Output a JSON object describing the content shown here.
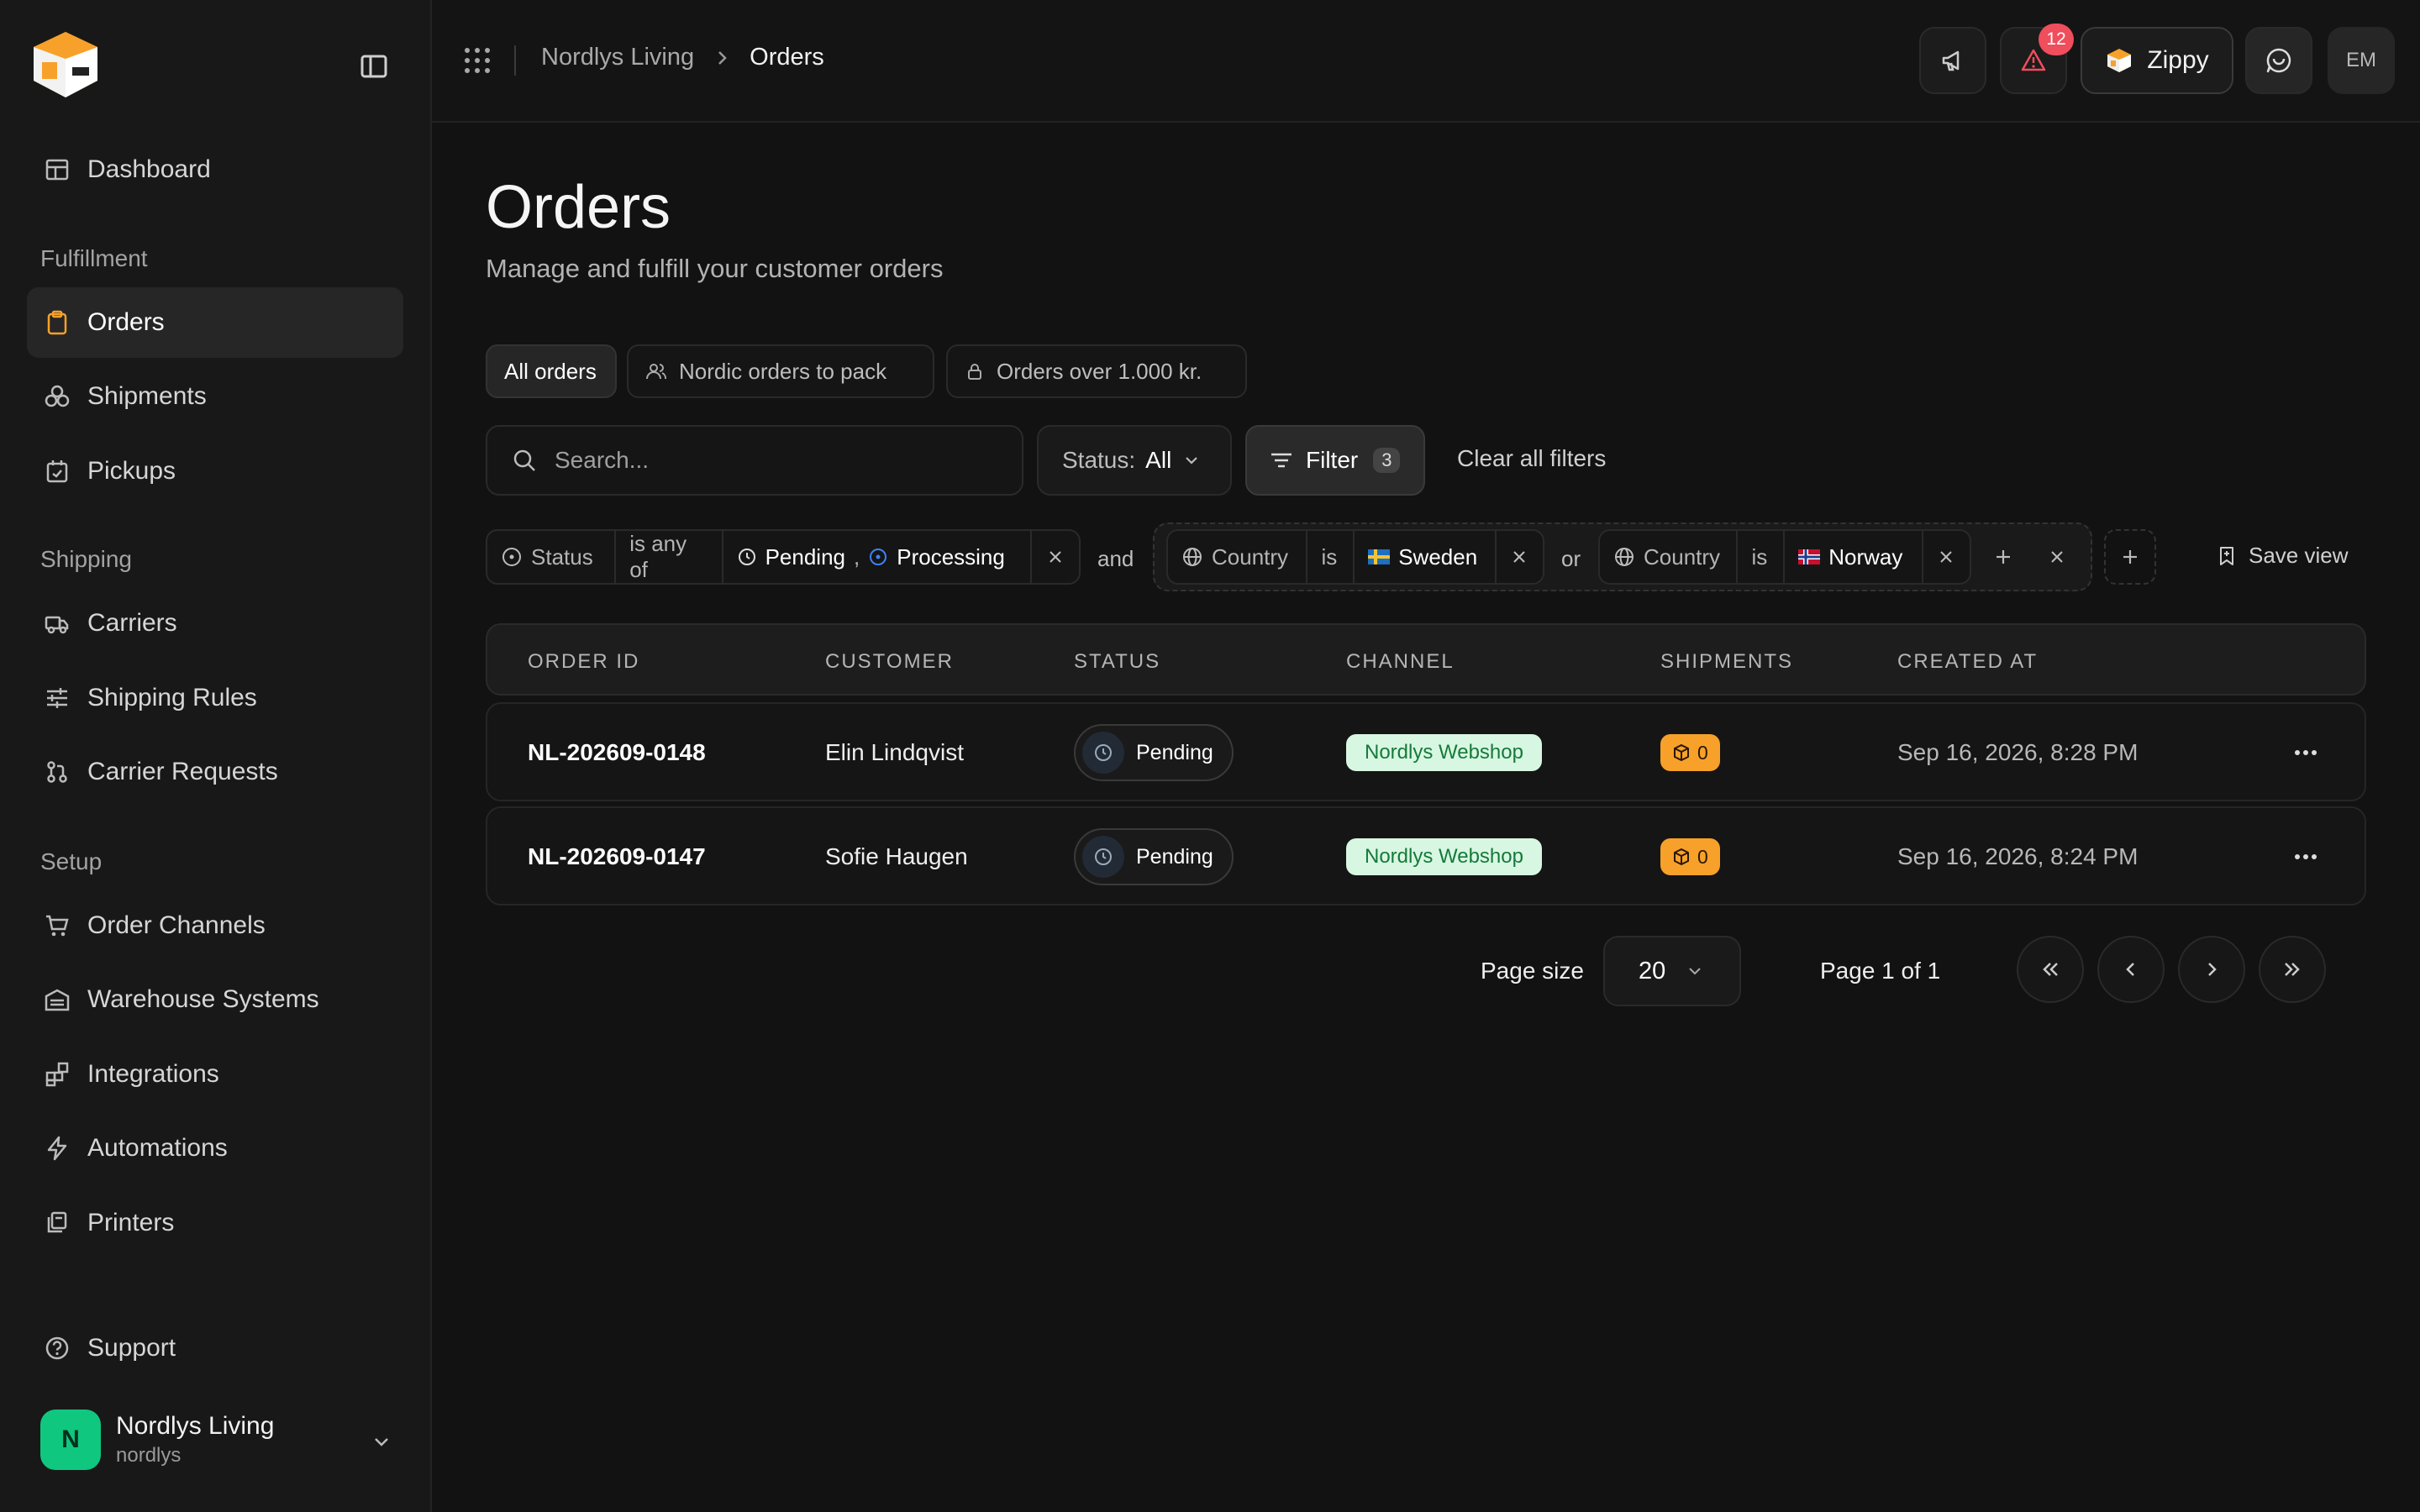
{
  "sidebar": {
    "dashboard": "Dashboard",
    "sections": {
      "fulfillment": "Fulfillment",
      "shipping": "Shipping",
      "setup": "Setup"
    },
    "items": {
      "orders": "Orders",
      "shipments": "Shipments",
      "pickups": "Pickups",
      "carriers": "Carriers",
      "shipping_rules": "Shipping Rules",
      "carrier_requests": "Carrier Requests",
      "order_channels": "Order Channels",
      "warehouse_systems": "Warehouse Systems",
      "integrations": "Integrations",
      "automations": "Automations",
      "printers": "Printers",
      "support": "Support"
    },
    "active_item": "orders",
    "org": {
      "initial": "N",
      "name": "Nordlys Living",
      "slug": "nordlys"
    }
  },
  "topbar": {
    "breadcrumb_parent": "Nordlys Living",
    "breadcrumb_current": "Orders",
    "notification_count": "12",
    "assistant_label": "Zippy",
    "user_initials": "EM"
  },
  "page": {
    "title": "Orders",
    "subtitle": "Manage and fulfill your customer orders"
  },
  "views": {
    "all": "All orders",
    "nordic": "Nordic orders to pack",
    "over": "Orders over 1.000 kr."
  },
  "toolbar": {
    "search_placeholder": "Search...",
    "status_label": "Status:",
    "status_value": "All",
    "filter_label": "Filter",
    "filter_count": "3",
    "clear_label": "Clear all filters"
  },
  "filters": {
    "status_field": "Status",
    "status_op": "is any of",
    "status_val1": "Pending",
    "status_sep": ",",
    "status_val2": "Processing",
    "and": "and",
    "country_field": "Country",
    "country_op": "is",
    "country1": "Sweden",
    "or": "or",
    "country2": "Norway",
    "save_view": "Save view"
  },
  "table": {
    "headers": {
      "order_id": "ORDER ID",
      "customer": "CUSTOMER",
      "status": "STATUS",
      "channel": "CHANNEL",
      "shipments": "SHIPMENTS",
      "created": "CREATED AT"
    },
    "rows": [
      {
        "order_id": "NL-202609-0148",
        "customer": "Elin Lindqvist",
        "status": "Pending",
        "channel": "Nordlys Webshop",
        "shipments": "0",
        "created": "Sep 16, 2026, 8:28 PM"
      },
      {
        "order_id": "NL-202609-0147",
        "customer": "Sofie Haugen",
        "status": "Pending",
        "channel": "Nordlys Webshop",
        "shipments": "0",
        "created": "Sep 16, 2026, 8:24 PM"
      }
    ]
  },
  "pagination": {
    "page_size_label": "Page size",
    "page_size": "20",
    "page_info": "Page 1 of 1"
  },
  "colors": {
    "accent_orange": "#f7a12a",
    "channel_green_bg": "#d8f7e2",
    "org_green": "#10c77f",
    "alert_red": "#ef4e5c"
  }
}
